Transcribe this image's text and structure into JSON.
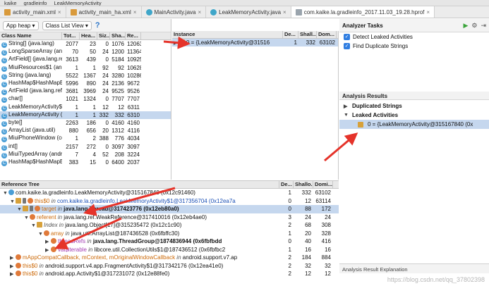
{
  "breadcrumb": [
    "kaike",
    "gradleinfo",
    "LeakMemoryActivity"
  ],
  "tabs": [
    {
      "label": "activity_main.xml",
      "icon": "xml-file-icon",
      "active": false
    },
    {
      "label": "activity_main_ha.xml",
      "icon": "xml-file-icon",
      "active": false
    },
    {
      "label": "MainActivity.java",
      "icon": "java-class-icon",
      "active": false
    },
    {
      "label": "LeakMemoryActivity.java",
      "icon": "java-class-icon",
      "active": false
    },
    {
      "label": "com.kaike.la.gradleinfo_2017.11.03_19.28.hprof",
      "icon": "hprof-file-icon",
      "active": true
    }
  ],
  "toolbar": {
    "heap_select": "App heap",
    "view_select": "Class List View",
    "help": "?"
  },
  "class_list": {
    "headers": [
      "Class Name",
      "Tot...",
      "Hea...",
      "Siz...",
      "Sha...",
      "Re..."
    ],
    "rows": [
      {
        "name": "String[] (java.lang)",
        "vals": [
          "2077",
          "23",
          "0",
          "1076",
          "12063"
        ],
        "sel": false
      },
      {
        "name": "LongSparseArray (android.u",
        "vals": [
          "70",
          "50",
          "24",
          "1200",
          "11364"
        ],
        "sel": false
      },
      {
        "name": "ArtField[] (java.lang.reflect)",
        "vals": [
          "3613",
          "439",
          "0",
          "5184",
          "10925"
        ],
        "sel": false
      },
      {
        "name": "MiuiResources$1 (android.",
        "vals": [
          "1",
          "1",
          "92",
          "92",
          "10628"
        ],
        "sel": false
      },
      {
        "name": "String (java.lang)",
        "vals": [
          "5522",
          "1367",
          "24",
          "3280",
          "10286"
        ],
        "sel": false
      },
      {
        "name": "HashMap$HashMapEntry (ja",
        "vals": [
          "5996",
          "890",
          "24",
          "2136",
          "9672"
        ],
        "sel": false
      },
      {
        "name": "ArtField (java.lang.reflect)",
        "vals": [
          "3681",
          "3969",
          "24",
          "9525",
          "9526"
        ],
        "sel": false
      },
      {
        "name": "char[]",
        "vals": [
          "1021",
          "1324",
          "0",
          "7707",
          "7707"
        ],
        "sel": false
      },
      {
        "name": "LeakMemoryActivity$1 (com",
        "vals": [
          "1",
          "1",
          "12",
          "12",
          "6311"
        ],
        "sel": false
      },
      {
        "name": "LeakMemoryActivity (com.l",
        "vals": [
          "1",
          "1",
          "332",
          "332",
          "6310"
        ],
        "sel": true
      },
      {
        "name": "byte[]",
        "vals": [
          "2263",
          "186",
          "0",
          "4160",
          "4160"
        ],
        "sel": false
      },
      {
        "name": "ArrayList (java.util)",
        "vals": [
          "880",
          "656",
          "20",
          "1312",
          "4116"
        ],
        "sel": false
      },
      {
        "name": "MiuiPhoneWindow (com.an",
        "vals": [
          "1",
          "2",
          "388",
          "776",
          "4034"
        ],
        "sel": false
      },
      {
        "name": "int[]",
        "vals": [
          "2157",
          "272",
          "0",
          "3097",
          "3097"
        ],
        "sel": false
      },
      {
        "name": "MiuiTypedArray (android.c",
        "vals": [
          "7",
          "4",
          "52",
          "208",
          "3224"
        ],
        "sel": false
      },
      {
        "name": "HashMap$HashMapEntry[]",
        "vals": [
          "383",
          "15",
          "0",
          "6400",
          "2037"
        ],
        "sel": false
      }
    ]
  },
  "instance": {
    "headers": [
      "Instance",
      "De...",
      "Shall...",
      "Dom..."
    ],
    "rows": [
      {
        "label": "0 = {LeakMemoryActivity@31516",
        "depth": "1",
        "shallow": "332",
        "dominating": "63102",
        "sel": true
      }
    ]
  },
  "analyzer": {
    "title": "Analyzer Tasks",
    "tasks": [
      {
        "label": "Detect Leaked Activities",
        "checked": true
      },
      {
        "label": "Find Duplicate Strings",
        "checked": true
      }
    ],
    "results_title": "Analysis Results",
    "results": [
      {
        "label": "Duplicated Strings",
        "expanded": false
      },
      {
        "label": "Leaked Activities",
        "expanded": true,
        "child": "0 = {LeakMemoryActivity@315167840 (0x"
      }
    ],
    "explanation_title": "Analysis Result Explanation"
  },
  "reference_tree": {
    "headers": [
      "Reference Tree",
      "De...",
      "Shallo...",
      "Domi..."
    ],
    "rows": [
      {
        "parts": [
          [
            "",
            "com.kaike.la.gradleinfo.LeakMemoryActivity@315167840 (0x12c91460)"
          ]
        ],
        "depth": "1",
        "shallow": "332",
        "dom": "63102",
        "indent": 0,
        "tri": "▼",
        "icons": [
          "obj"
        ],
        "sel": false
      },
      {
        "parts": [
          [
            "orange",
            "this$0"
          ],
          [
            "it",
            " in "
          ],
          [
            "blue",
            "com.kaike.la.gradleinfo.LeakMemoryActivity$1@317356704 (0x12ea7a"
          ]
        ],
        "depth": "0",
        "shallow": "12",
        "dom": "63114",
        "indent": 1,
        "tri": "▼",
        "icons": [
          "arr",
          "pin",
          "fld"
        ],
        "sel": false
      },
      {
        "parts": [
          [
            "orange",
            "target"
          ],
          [
            "it",
            " in "
          ],
          [
            "bold",
            "java.lang.Thread@317423776 (0x12eb80a0)"
          ]
        ],
        "depth": "0",
        "shallow": "88",
        "dom": "172",
        "indent": 2,
        "tri": "▼",
        "icons": [
          "arr",
          "pin",
          "fld"
        ],
        "sel": true
      },
      {
        "parts": [
          [
            "orange",
            "referent"
          ],
          [
            "it",
            " in "
          ],
          [
            "",
            "java.lang.ref.WeakReference@317410016 (0x12eb4ae0)"
          ]
        ],
        "depth": "3",
        "shallow": "24",
        "dom": "24",
        "indent": 3,
        "tri": "▼",
        "icons": [
          "fld"
        ],
        "sel": false
      },
      {
        "parts": [
          [
            "it",
            "Index"
          ],
          [
            "it",
            " in "
          ],
          [
            "",
            "java.lang.Object[17]@315235472 (0x12c1c90)"
          ]
        ],
        "depth": "2",
        "shallow": "68",
        "dom": "308",
        "indent": 4,
        "tri": "▼",
        "icons": [
          "arr"
        ],
        "sel": false
      },
      {
        "parts": [
          [
            "orange",
            "array"
          ],
          [
            "it",
            " in "
          ],
          [
            "",
            "java.util.ArrayList@187436528 (0x6fbffc30)"
          ]
        ],
        "depth": "1",
        "shallow": "20",
        "dom": "328",
        "indent": 5,
        "tri": "▼",
        "icons": [
          "fld"
        ],
        "sel": false
      },
      {
        "parts": [
          [
            "magenta",
            "threadRefs"
          ],
          [
            "it",
            " in "
          ],
          [
            "bold",
            "java.lang.ThreadGroup@1874836944 (0x6fbfbdd"
          ]
        ],
        "depth": "0",
        "shallow": "40",
        "dom": "416",
        "indent": 6,
        "tri": "▶",
        "icons": [
          "fld"
        ],
        "sel": false
      },
      {
        "parts": [
          [
            "magenta",
            "val$iterable"
          ],
          [
            "it",
            " in "
          ],
          [
            "",
            "libcore.util.CollectionUtils$1@187436512 (0x6fbfbc2"
          ]
        ],
        "depth": "1",
        "shallow": "16",
        "dom": "16",
        "indent": 6,
        "tri": "▶",
        "icons": [
          "fld"
        ],
        "sel": false
      },
      {
        "parts": [
          [
            "orange",
            "mAppCompatCallback, mContext, mOriginalWindowCallback"
          ],
          [
            "it",
            " in "
          ],
          [
            "",
            "android.support.v7.ap"
          ]
        ],
        "depth": "2",
        "shallow": "184",
        "dom": "884",
        "indent": 1,
        "tri": "▶",
        "icons": [
          "fld"
        ],
        "sel": false
      },
      {
        "parts": [
          [
            "orange",
            "this$0"
          ],
          [
            "it",
            " in "
          ],
          [
            "",
            "android.support.v4.app.FragmentActivity$1@317342176 (0x12ea41e0)"
          ]
        ],
        "depth": "2",
        "shallow": "32",
        "dom": "32",
        "indent": 1,
        "tri": "▶",
        "icons": [
          "fld"
        ],
        "sel": false
      },
      {
        "parts": [
          [
            "orange",
            "this$0"
          ],
          [
            "it",
            " in "
          ],
          [
            "",
            "android.app.Activity$1@317231072 (0x12e88fe0)"
          ]
        ],
        "depth": "2",
        "shallow": "12",
        "dom": "12",
        "indent": 1,
        "tri": "▶",
        "icons": [
          "fld"
        ],
        "sel": false
      }
    ]
  },
  "watermark": "https://blog.csdn.net/qq_37802398",
  "colors": {
    "selection": "#c5d7ee",
    "accent": "#2f7de1",
    "arrow": "#e5332a"
  }
}
